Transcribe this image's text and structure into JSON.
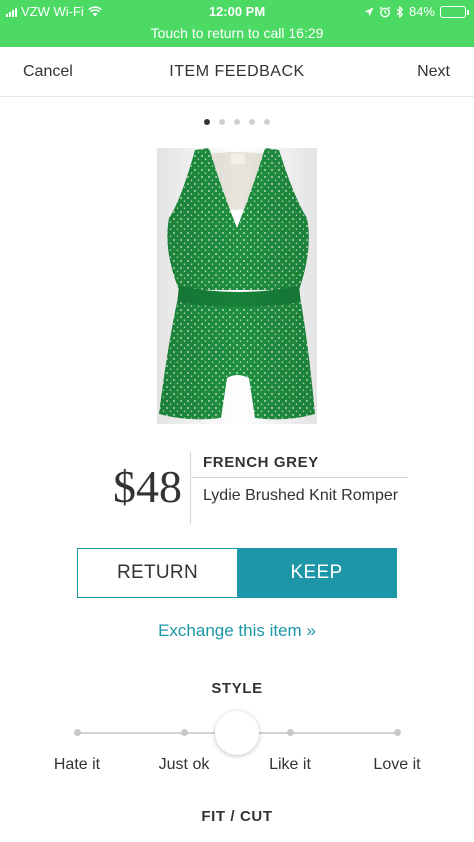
{
  "status_bar": {
    "carrier": "VZW Wi-Fi",
    "time": "12:00 PM",
    "battery": "84%",
    "battery_level": 0.84,
    "call_banner": "Touch to return to call 16:29",
    "background_color": "#4cd964"
  },
  "nav": {
    "cancel_label": "Cancel",
    "title": "ITEM FEEDBACK",
    "next_label": "Next"
  },
  "pager": {
    "count": 5,
    "active_index": 0
  },
  "product": {
    "image_icon": "green-romper-image",
    "price": "$48",
    "brand": "FRENCH GREY",
    "name": "Lydie Brushed Knit Romper"
  },
  "actions": {
    "return_label": "RETURN",
    "keep_label": "KEEP",
    "selected": "KEEP",
    "accent_color": "#1d96a7"
  },
  "exchange_link": "Exchange this item »",
  "style_rating": {
    "title": "STYLE",
    "options": [
      "Hate it",
      "Just ok",
      "Like it",
      "Love it"
    ],
    "selected": null
  },
  "fit_section": {
    "title": "FIT / CUT"
  }
}
